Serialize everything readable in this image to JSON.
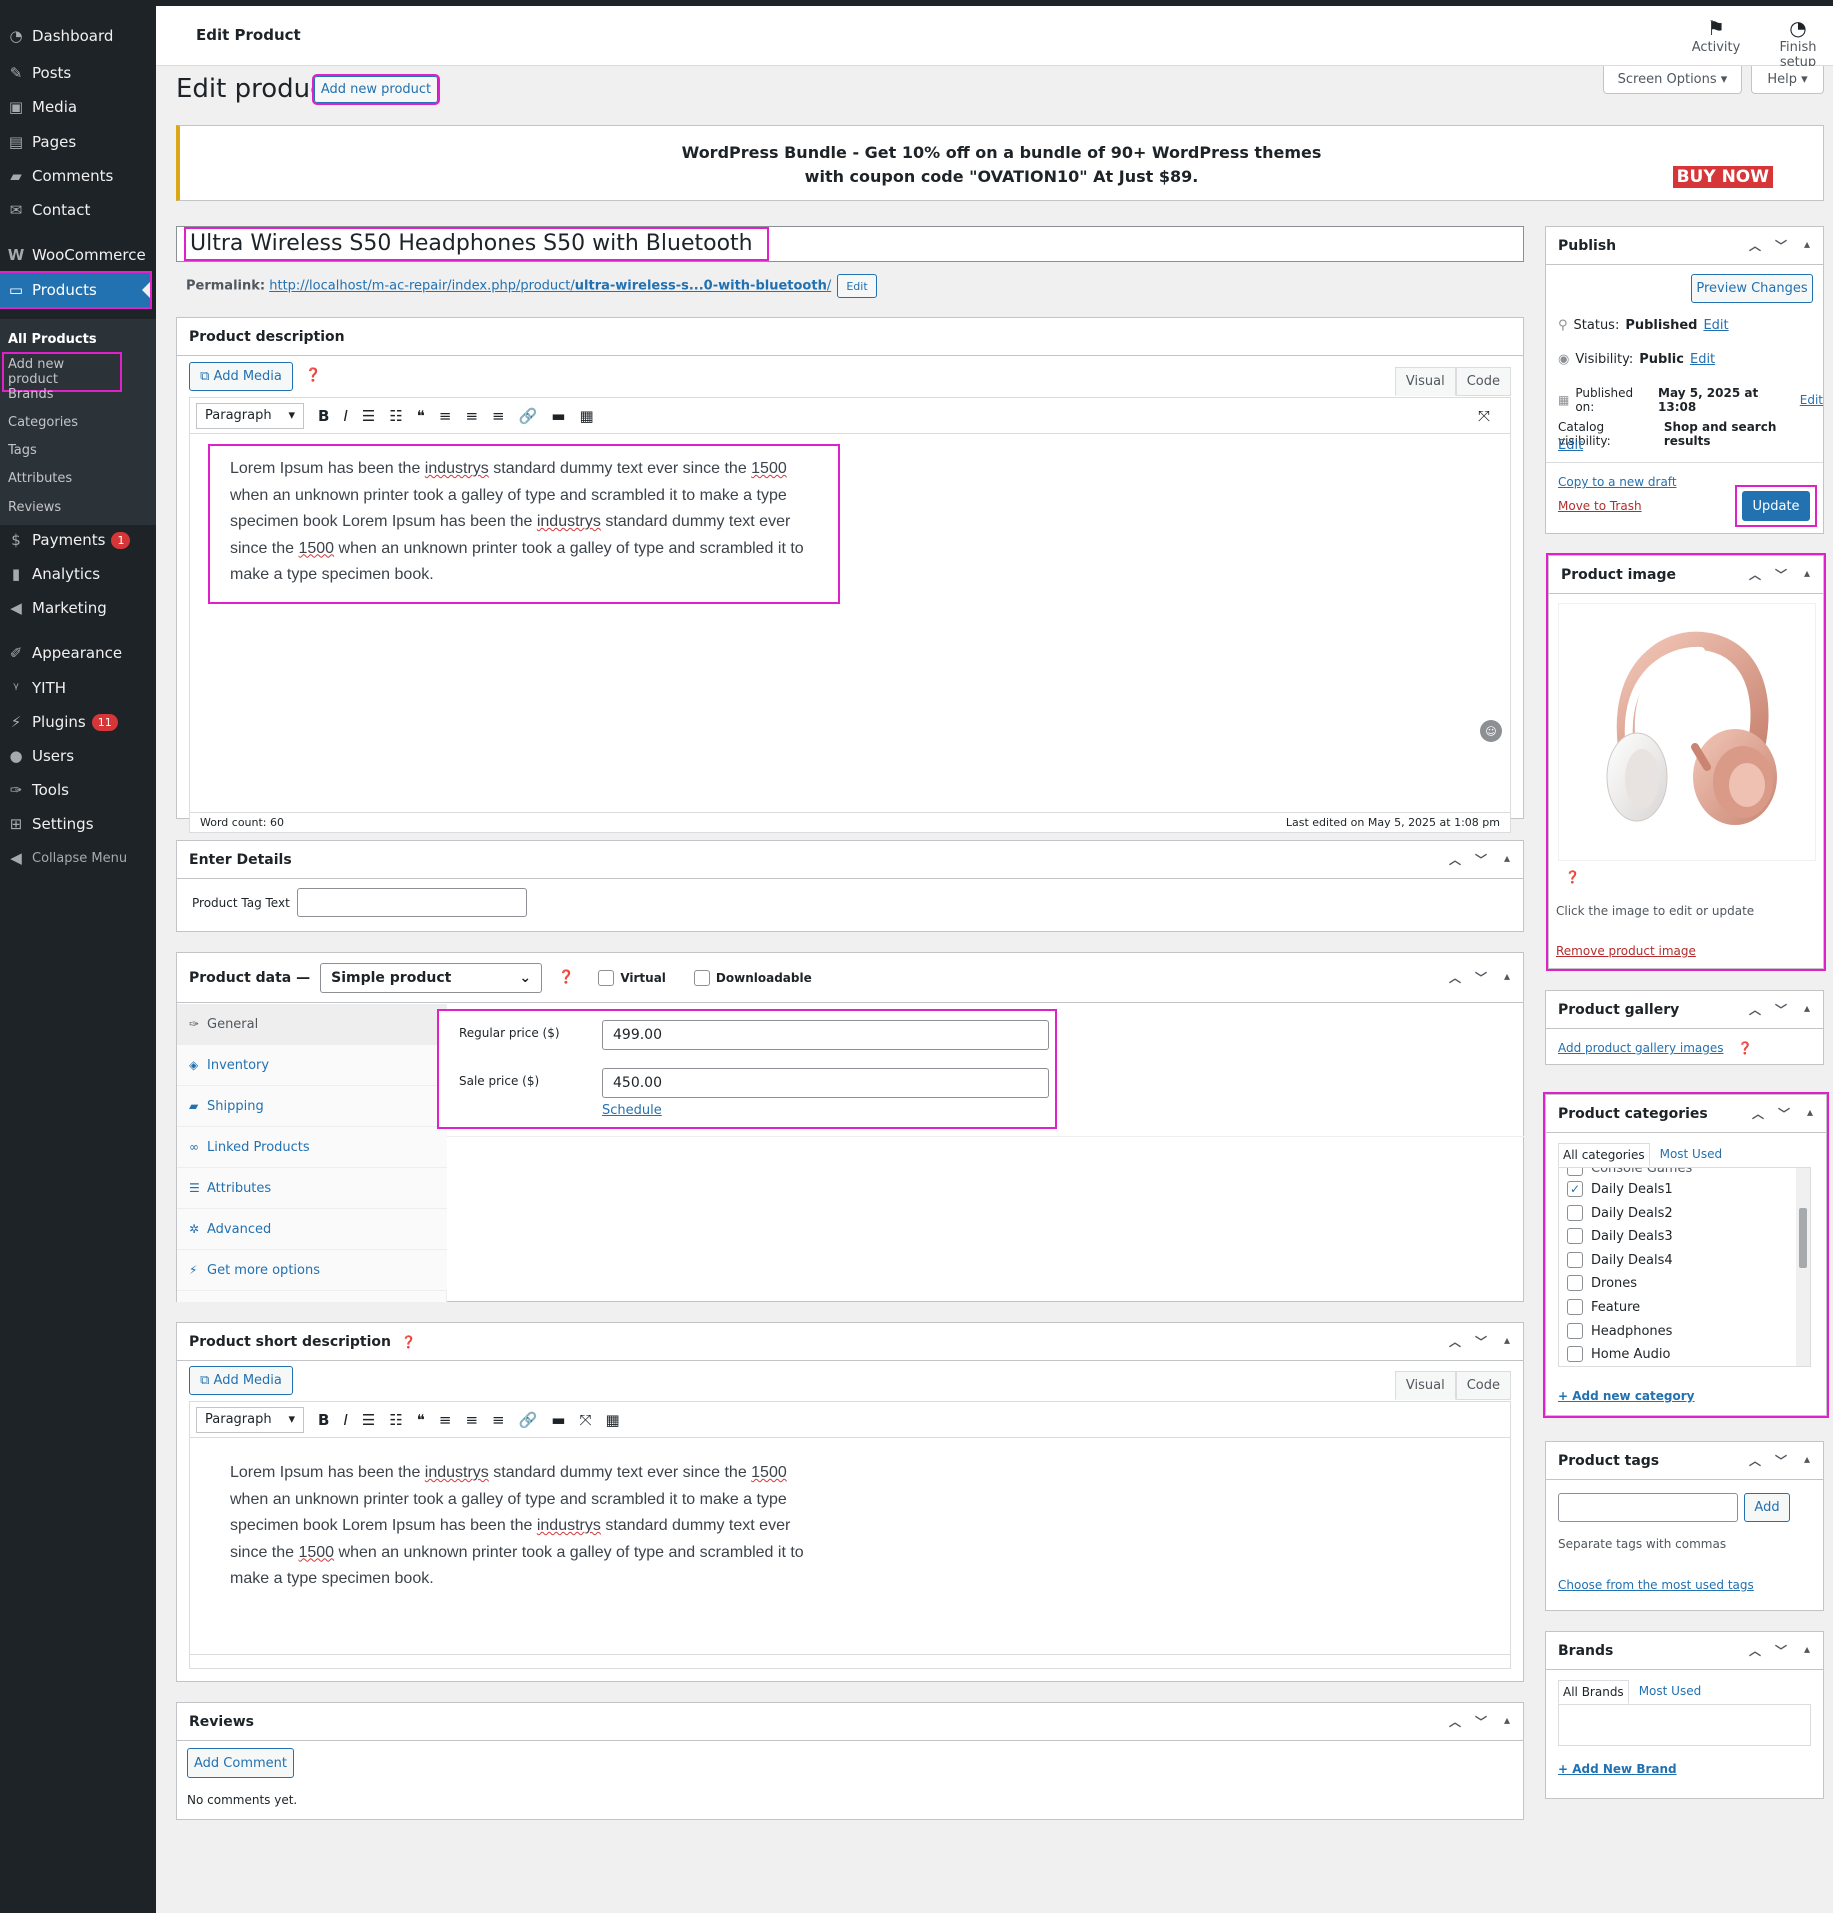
{
  "sidebar": {
    "items": [
      {
        "label": "Dashboard",
        "icon": "dashboard-icon"
      },
      {
        "label": "Posts",
        "icon": "pin-icon"
      },
      {
        "label": "Media",
        "icon": "media-icon"
      },
      {
        "label": "Pages",
        "icon": "pages-icon"
      },
      {
        "label": "Comments",
        "icon": "comments-icon"
      },
      {
        "label": "Contact",
        "icon": "mail-icon"
      },
      {
        "label": "WooCommerce",
        "icon": "woocommerce-icon"
      },
      {
        "label": "Products",
        "icon": "products-icon"
      },
      {
        "label": "Payments",
        "icon": "payments-icon",
        "badge": "1"
      },
      {
        "label": "Analytics",
        "icon": "analytics-icon"
      },
      {
        "label": "Marketing",
        "icon": "megaphone-icon"
      },
      {
        "label": "Appearance",
        "icon": "brush-icon"
      },
      {
        "label": "YITH",
        "icon": "yith-icon"
      },
      {
        "label": "Plugins",
        "icon": "plugin-icon",
        "badge": "11"
      },
      {
        "label": "Users",
        "icon": "users-icon"
      },
      {
        "label": "Tools",
        "icon": "wrench-icon"
      },
      {
        "label": "Settings",
        "icon": "settings-icon"
      },
      {
        "label": "Collapse Menu",
        "icon": "collapse-icon"
      }
    ],
    "submenu": [
      "All Products",
      "Add new product",
      "Brands",
      "Categories",
      "Tags",
      "Attributes",
      "Reviews"
    ]
  },
  "header": {
    "title": "Edit Product",
    "activity": "Activity",
    "finish_setup": "Finish setup"
  },
  "page": {
    "title": "Edit product",
    "add_new": "Add new product",
    "screen_options": "Screen Options",
    "help": "Help"
  },
  "banner": {
    "line1": "WordPress Bundle - Get 10% off on a bundle of 90+ WordPress themes",
    "line2": "with coupon code \"OVATION10\" At Just $89.",
    "buy": "BUY NOW"
  },
  "product": {
    "title": "Ultra Wireless S50 Headphones S50 with Bluetooth",
    "permalink_label": "Permalink:",
    "permalink_base": "http://localhost/m-ac-repair/index.php/product/",
    "permalink_slug": "ultra-wireless-s...0-with-bluetooth",
    "permalink_end": "/",
    "permalink_edit": "Edit"
  },
  "description": {
    "title": "Product description",
    "add_media": "Add Media",
    "tab_visual": "Visual",
    "tab_code": "Code",
    "format": "Paragraph",
    "t1": "Lorem Ipsum has been the ",
    "t2": "industrys",
    "t3": " standard dummy text ever since the ",
    "t4": "1500",
    "t5": "when an unknown printer took a galley of type and scrambled it to make a type",
    "t6": "specimen book Lorem Ipsum has been the ",
    "t7": "industrys",
    "t8": " standard dummy text ever",
    "t9": "since the ",
    "t10": "1500",
    "t11": " when an unknown printer took a galley of type and scrambled it to",
    "t12": "make a type specimen book.",
    "word_count": "Word count: 60",
    "last_edited": "Last edited on May 5, 2025 at 1:08 pm"
  },
  "details": {
    "title": "Enter Details",
    "tag_label": "Product Tag Text",
    "tag_value": ""
  },
  "product_data": {
    "title": "Product data —",
    "type": "Simple product",
    "virtual": "Virtual",
    "downloadable": "Downloadable",
    "tabs": [
      {
        "label": "General",
        "icon": "wrench-icon"
      },
      {
        "label": "Inventory",
        "icon": "tag-icon"
      },
      {
        "label": "Shipping",
        "icon": "truck-icon"
      },
      {
        "label": "Linked Products",
        "icon": "link-icon"
      },
      {
        "label": "Attributes",
        "icon": "list-icon"
      },
      {
        "label": "Advanced",
        "icon": "gear-icon"
      },
      {
        "label": "Get more options",
        "icon": "plugin-icon"
      }
    ],
    "regular_label": "Regular price ($)",
    "regular_value": "499.00",
    "sale_label": "Sale price ($)",
    "sale_value": "450.00",
    "schedule": "Schedule"
  },
  "short_desc": {
    "title": "Product short description",
    "add_media": "Add Media",
    "tab_visual": "Visual",
    "tab_code": "Code",
    "format": "Paragraph"
  },
  "reviews": {
    "title": "Reviews",
    "add_comment": "Add Comment",
    "empty": "No comments yet."
  },
  "publish": {
    "title": "Publish",
    "preview": "Preview Changes",
    "status_label": "Status:",
    "status_value": "Published",
    "edit": "Edit",
    "visibility_label": "Visibility:",
    "visibility_value": "Public",
    "published_label": "Published on:",
    "published_value": "May 5, 2025 at 13:08",
    "catalog_label": "Catalog visibility:",
    "catalog_value": "Shop and search results",
    "copy": "Copy to a new draft",
    "trash": "Move to Trash",
    "update": "Update"
  },
  "product_image": {
    "title": "Product image",
    "hint": "Click the image to edit or update",
    "remove": "Remove product image"
  },
  "gallery": {
    "title": "Product gallery",
    "add": "Add product gallery images"
  },
  "categories": {
    "title": "Product categories",
    "tab_all": "All categories",
    "tab_used": "Most Used",
    "partial": "Console Games",
    "items": [
      {
        "label": "Daily Deals1",
        "checked": true
      },
      {
        "label": "Daily Deals2",
        "checked": false
      },
      {
        "label": "Daily Deals3",
        "checked": false
      },
      {
        "label": "Daily Deals4",
        "checked": false
      },
      {
        "label": "Drones",
        "checked": false
      },
      {
        "label": "Feature",
        "checked": false
      },
      {
        "label": "Headphones",
        "checked": false
      },
      {
        "label": "Home Audio",
        "checked": false
      }
    ],
    "add": "+ Add new category"
  },
  "tags": {
    "title": "Product tags",
    "add": "Add",
    "hint": "Separate tags with commas",
    "choose": "Choose from the most used tags"
  },
  "brands": {
    "title": "Brands",
    "tab_all": "All Brands",
    "tab_used": "Most Used",
    "add": "+ Add New Brand"
  },
  "colors": {
    "accent": "#2271b1",
    "highlight": "#e020c8",
    "admin_bar": "#1d2327",
    "danger": "#d63638"
  }
}
